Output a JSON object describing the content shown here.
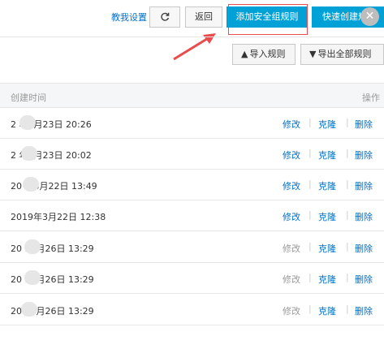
{
  "toolbar": {
    "teach_link": "教我设置",
    "refresh_icon": "refresh-icon",
    "back_label": "返回",
    "add_rule_label": "添加安全组规则",
    "quick_create_label": "快速创建规",
    "close_icon": "close-icon"
  },
  "actions2": {
    "import_label": "导入规则",
    "export_label": "导出全部规则"
  },
  "table": {
    "headers": {
      "time": "创建时间",
      "ops": "操作"
    },
    "rows": [
      {
        "time": "2 年3月23日 20:26",
        "modify": "修改",
        "clone": "克隆",
        "delete": "删除",
        "modify_enabled": true
      },
      {
        "time": "2 年3月23日 20:02",
        "modify": "修改",
        "clone": "克隆",
        "delete": "删除",
        "modify_enabled": true
      },
      {
        "time": "20 年3月22日 13:49",
        "modify": "修改",
        "clone": "克隆",
        "delete": "删除",
        "modify_enabled": true
      },
      {
        "time": "2019年3月22日 12:38",
        "modify": "修改",
        "clone": "克隆",
        "delete": "删除",
        "modify_enabled": true
      },
      {
        "time": "20 11月26日 13:29",
        "modify": "修改",
        "clone": "克隆",
        "delete": "删除",
        "modify_enabled": false
      },
      {
        "time": "20 11月26日 13:29",
        "modify": "修改",
        "clone": "克隆",
        "delete": "删除",
        "modify_enabled": false
      },
      {
        "time": "20 11月26日 13:29",
        "modify": "修改",
        "clone": "克隆",
        "delete": "删除",
        "modify_enabled": false
      }
    ]
  },
  "colors": {
    "accent": "#00a1d6",
    "link": "#0070cc",
    "highlight": "#e84c4c"
  }
}
